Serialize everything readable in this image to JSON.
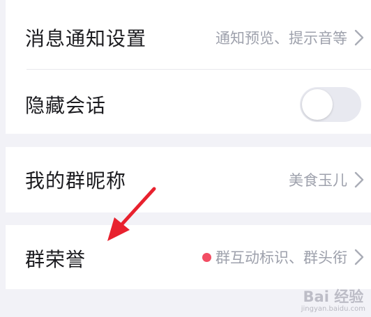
{
  "settings": {
    "items": [
      {
        "label": "消息通知设置",
        "detail": "通知预览、提示音等"
      },
      {
        "label": "隐藏会话",
        "toggle_on": false
      },
      {
        "label": "我的群昵称",
        "detail": "美食玉儿"
      },
      {
        "label": "群荣誉",
        "detail": "群互动标识、群头衔",
        "has_red_dot": true
      }
    ]
  },
  "watermark": {
    "main": "Bai 经验",
    "sub": "jingyan.baidu.com"
  },
  "colors": {
    "arrow": "#e8212e",
    "red_dot": "#f24d63",
    "background": "#f2f2f7"
  }
}
